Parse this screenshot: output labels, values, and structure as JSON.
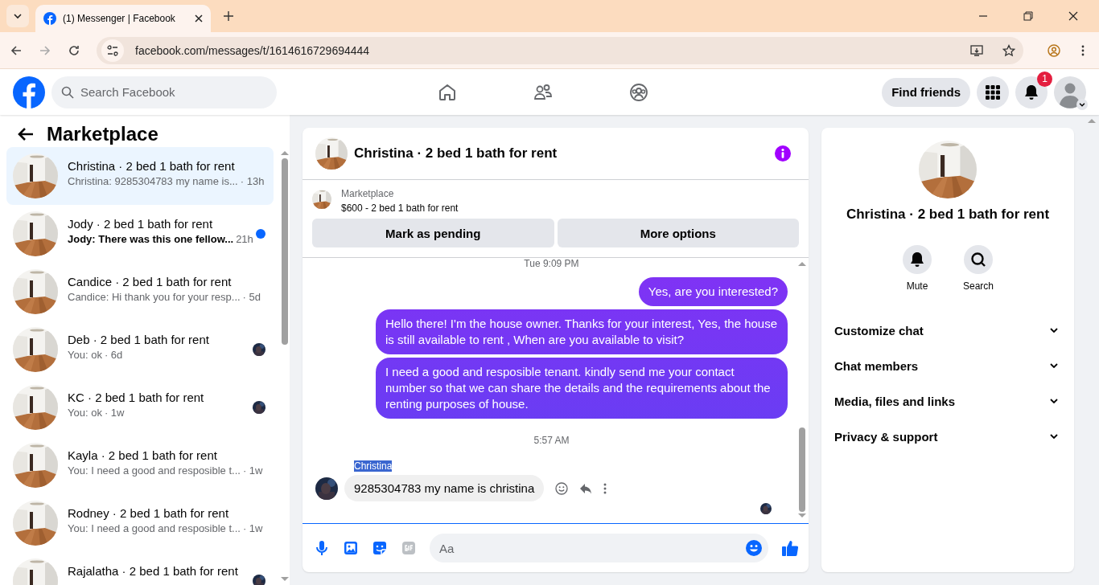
{
  "browser": {
    "tab_title": "(1) Messenger | Facebook",
    "url": "facebook.com/messages/t/1614616729694444"
  },
  "header": {
    "search_placeholder": "Search Facebook",
    "find_friends": "Find friends",
    "notification_count": "1"
  },
  "sidebar": {
    "title": "Marketplace",
    "conversations": [
      {
        "title": "Christina · 2 bed 1 bath for rent",
        "preview": "Christina: 9285304783 my name is...",
        "time": "· 13h",
        "selected": true,
        "kind": "read"
      },
      {
        "title": "Jody · 2 bed 1 bath for rent",
        "preview": "Jody: There was this one fellow...",
        "time": "21h",
        "selected": false,
        "kind": "unread"
      },
      {
        "title": "Candice · 2 bed 1 bath for rent",
        "preview": "Candice: Hi thank you for your resp...",
        "time": "· 5d",
        "selected": false,
        "kind": "read"
      },
      {
        "title": "Deb · 2 bed 1 bath for rent",
        "preview": "You: ok",
        "time": "· 6d",
        "selected": false,
        "kind": "seen"
      },
      {
        "title": "KC · 2 bed 1 bath for rent",
        "preview": "You: ok",
        "time": "· 1w",
        "selected": false,
        "kind": "seen"
      },
      {
        "title": "Kayla · 2 bed 1 bath for rent",
        "preview": "You: I need a good and resposible t...",
        "time": "· 1w",
        "selected": false,
        "kind": "read"
      },
      {
        "title": "Rodney · 2 bed 1 bath for rent",
        "preview": "You: I need a good and resposible t...",
        "time": "· 1w",
        "selected": false,
        "kind": "read"
      },
      {
        "title": "Rajalatha · 2 bed 1 bath for rent",
        "selected": false,
        "kind": "seen"
      }
    ]
  },
  "chat": {
    "title": "Christina · 2 bed 1 bath for rent",
    "listing": {
      "label": "Marketplace",
      "title": "$600 - 2 bed 1 bath for rent"
    },
    "actions": [
      "Mark as pending",
      "More options"
    ],
    "messages": [
      {
        "kind": "time",
        "text": "Tue 9:09 PM"
      },
      {
        "kind": "sent",
        "text": "Yes, are you interested?"
      },
      {
        "kind": "sent",
        "text": "Hello there! I'm the house owner. Thanks for your interest, Yes, the house is still available to rent , When are you available to visit?"
      },
      {
        "kind": "sent",
        "text": "I need a good and resposible tenant.  kindly send me your contact number so that we can share the details and the requirements about the renting purposes of house."
      },
      {
        "kind": "time",
        "text": "5:57 AM"
      },
      {
        "kind": "received",
        "sender": "Christina",
        "text": "9285304783 my name is christina"
      }
    ],
    "composer": {
      "placeholder": "Aa"
    }
  },
  "details": {
    "title": "Christina · 2 bed 1 bath for rent",
    "actions": [
      "Mute",
      "Search"
    ],
    "sections": [
      "Customize chat",
      "Chat members",
      "Media, files and links",
      "Privacy & support"
    ]
  }
}
